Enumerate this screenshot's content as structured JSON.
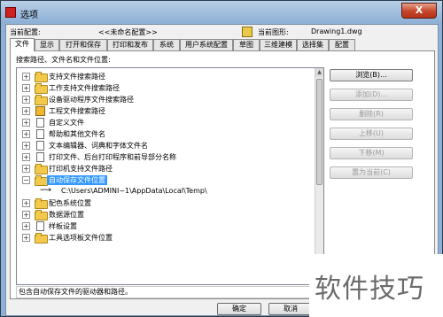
{
  "window": {
    "title": "选项",
    "close_label": "X"
  },
  "info": {
    "profile_label": "当前配置:",
    "profile_value": "<<未命名配置>>",
    "drawing_label": "当前图形:",
    "drawing_value": "Drawing1.dwg"
  },
  "tabs": [
    "文件",
    "显示",
    "打开和保存",
    "打印和发布",
    "系统",
    "用户系统配置",
    "草图",
    "三维建模",
    "选择集",
    "配置"
  ],
  "section_label": "搜索路径、文件名和文件位置:",
  "tree": [
    {
      "label": "支持文件搜索路径",
      "icon": "folder-icon"
    },
    {
      "label": "工作支持文件搜索路径",
      "icon": "folder-icon"
    },
    {
      "label": "设备驱动程序文件搜索路径",
      "icon": "folder-icon"
    },
    {
      "label": "工程文件搜索路径",
      "icon": "book-icon"
    },
    {
      "label": "自定义文件",
      "icon": "document-icon"
    },
    {
      "label": "帮助和其他文件名",
      "icon": "document-icon"
    },
    {
      "label": "文本编辑器、词典和字体文件名",
      "icon": "document-icon"
    },
    {
      "label": "打印文件、后台打印程序和前导部分名称",
      "icon": "document-icon"
    },
    {
      "label": "打印机支持文件路径",
      "icon": "folder-icon"
    },
    {
      "label": "自动保存文件位置",
      "icon": "folder-icon",
      "selected": true
    },
    {
      "label": "C:\\Users\\ADMINI~1\\AppData\\Local\\Temp\\",
      "icon": "arrow-icon"
    },
    {
      "label": "配色系统位置",
      "icon": "folder-icon"
    },
    {
      "label": "数据源位置",
      "icon": "folder-icon"
    },
    {
      "label": "样板设置",
      "icon": "document-icon"
    },
    {
      "label": "工具选项板文件位置",
      "icon": "folder-icon"
    }
  ],
  "buttons": {
    "browse": "浏览(B)...",
    "add": "添加(D)...",
    "remove": "删除(R)",
    "move_up": "上移(U)",
    "move_down": "下移(M)",
    "set_current": "置为当前(C)"
  },
  "description": "包含自动保存文件的驱动器和路径。",
  "footer": {
    "ok": "确定",
    "cancel": "取消"
  },
  "watermark": "软件技巧",
  "colors": {
    "selection": "#3399ff",
    "folder": "#f3c94b",
    "close_button": "#c4452a"
  }
}
